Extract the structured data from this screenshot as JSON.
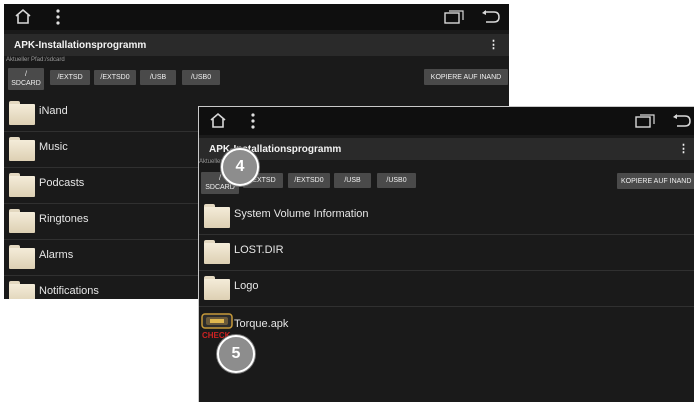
{
  "back_screen": {
    "status_icons": {
      "home": "home-icon",
      "overflow": "overflow-icon",
      "recents": "recents-icon",
      "back": "back-icon"
    },
    "app_title": "APK-Installationsprogramm",
    "menu_glyph": "⋮",
    "path_label": "Aktueller Pfad:/sdcard",
    "buttons": [
      "/\nSDCARD",
      "/EXTSD",
      "/EXTSD0",
      "/USB",
      "/USB0"
    ],
    "copy_button": "KOPIERE AUF INAND",
    "folders": [
      "iNand",
      "Music",
      "Podcasts",
      "Ringtones",
      "Alarms",
      "Notifications"
    ]
  },
  "front_screen": {
    "app_title": "APK-Installationsprogramm",
    "menu_glyph": "⋮",
    "path_label": "Aktueller Pfad:/sdcard",
    "buttons": [
      "/\nSDCARD",
      "/EXTSD",
      "/EXTSD0",
      "/USB",
      "/USB0"
    ],
    "copy_button": "KOPIERE AUF INAND",
    "items": [
      "System Volume Information",
      "LOST.DIR",
      "Logo",
      "Torque.apk"
    ],
    "apk_icon_text": "CHECK"
  },
  "callouts": [
    "4",
    "5"
  ]
}
